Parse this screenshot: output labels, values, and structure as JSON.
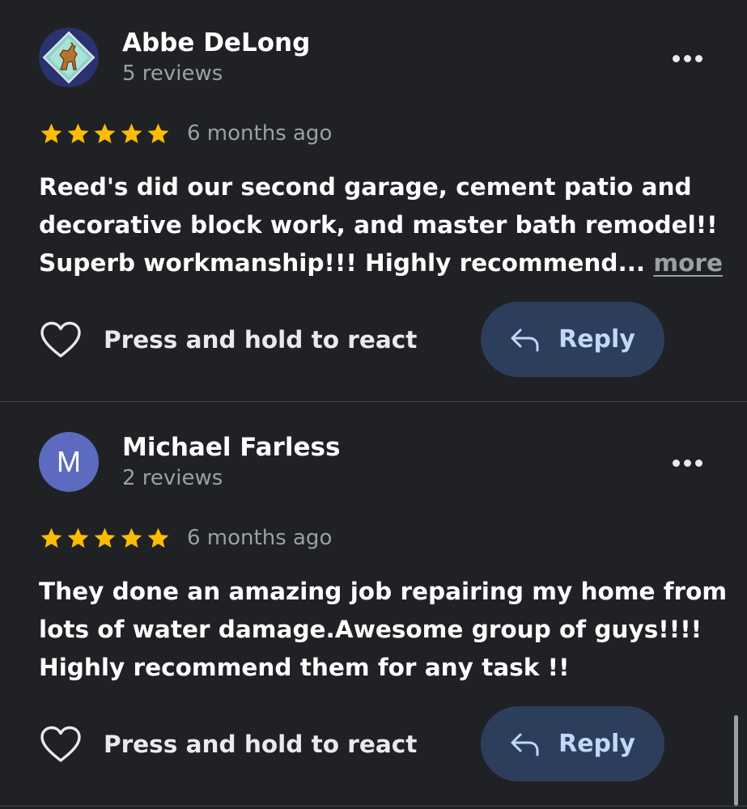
{
  "reviews": [
    {
      "author": "Abbe DeLong",
      "review_count": "5 reviews",
      "rating": 5,
      "time": "6 months ago",
      "text_lines": [
        "Reed's did our second garage, cement patio and",
        "decorative block work, and master bath remodel!!",
        "Superb workmanship!!! Highly recommend..."
      ],
      "more_label": "more",
      "react_label": "Press and hold to react",
      "reply_label": "Reply",
      "avatar": "horse-picture"
    },
    {
      "author": "Michael Farless",
      "review_count": "2 reviews",
      "rating": 5,
      "time": "6 months ago",
      "text_lines": [
        "They done an amazing job repairing my home from",
        "lots of water damage.Awesome group of guys!!!!",
        "Highly recommend them for any task !!"
      ],
      "react_label": "Press and hold to react",
      "reply_label": "Reply",
      "avatar_letter": "M"
    }
  ],
  "colors": {
    "background": "#202124",
    "star": "#fbbc04",
    "reply_button_bg": "#2d3e5c",
    "reply_text": "#c2d7fb",
    "secondary_text": "#9aa0a6"
  },
  "icons": {
    "overflow": "more-vert-dots-icon",
    "react": "heart-outline-icon",
    "reply": "reply-arrow-icon",
    "rating": "star-icon"
  }
}
